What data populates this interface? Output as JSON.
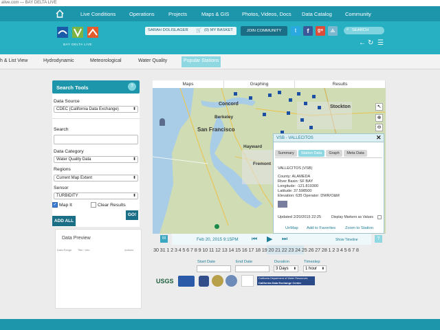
{
  "browser": {
    "url_fragment": "alive.com — BAY DELTA LIVE"
  },
  "topnav": {
    "items": [
      "Live Conditions",
      "Operations",
      "Projects",
      "Maps & GIS",
      "Photos, Videos, Docs",
      "Data Catalog",
      "Community"
    ]
  },
  "header": {
    "logo_text": "BAY·DELTA LIVE",
    "user": "SARAH DOLISLAGER",
    "basket": "(0) MY BASKET",
    "join": "JOIN COMMUNITY",
    "search_placeholder": "SEARCH",
    "colors": {
      "header_bg": "#27b0c1",
      "nav_bg": "#1d95aa",
      "active_tab": "#8fd8e2"
    }
  },
  "tabs": [
    "h & List View",
    "Hydrodynamic",
    "Meteorological",
    "Water Quality",
    "Popular Stations"
  ],
  "search_tools": {
    "title": "Search Tools",
    "data_source_label": "Data Source",
    "data_source_value": "CDEC (California Data Exchange)",
    "search_label": "Search",
    "data_category_label": "Data Category",
    "data_category_value": "Water Quality Data",
    "regions_label": "Regions",
    "regions_value": "Current Map Extent",
    "sensor_label": "Sensor",
    "sensor_value": "TURBIDITY",
    "map_it": "Map It",
    "map_it_checked": true,
    "clear_results": "Clear Results",
    "clear_checked": false,
    "add_all": "ADD ALL",
    "go": "GO!"
  },
  "data_preview": {
    "title": "Data Preview",
    "columns": [
      "Data Range",
      "Title / Info",
      "Actions"
    ]
  },
  "map_tabs": [
    "Maps",
    "Graphing",
    "Results"
  ],
  "map_labels": [
    "Concord",
    "Stockton",
    "Berkeley",
    "San Francisco",
    "Hayward",
    "Fremont"
  ],
  "popup": {
    "title": "VSB - VALLECITOS",
    "tabs": [
      "Summary",
      "Station Data",
      "Graph",
      "Meta Data"
    ],
    "active_tab": "Station Data",
    "station": "VALLECITOS (VSB)",
    "county": "County: ALAMEDA",
    "river_basin": "River Basin: SF BAY",
    "longitude": "Longitude: -121.819300",
    "latitude": "Latitude: 37.598500",
    "elevation": "Elevation: 635 Operator: DWR/O&M",
    "updated": "Updated 2/20/2015 22:25",
    "display_markers": "Display Markers as Values",
    "actions": [
      "UnMap",
      "Add to Favorites",
      "Zoom to Station"
    ]
  },
  "timebar": {
    "m_label": "M",
    "current": "Feb 20, 2015 9:15PM",
    "show_timeline": "Show Timeline",
    "help": "?"
  },
  "timeline_days": "30 31 1  2  3  4  5  6  7  8  9 10 11 12 13 14 15 16 17 18 19 20 21 22 23 24 25 26 27 28  1  2  3  4  5  6  7  8",
  "date_controls": {
    "start_label": "Start Date",
    "end_label": "End Date",
    "duration_label": "Duration",
    "duration_value": "3 Days",
    "timestep_label": "Timestep",
    "timestep_value": "1 hour"
  },
  "logos": [
    "USGS",
    "California Department of Water Resources",
    "California Data Exchange Center"
  ]
}
